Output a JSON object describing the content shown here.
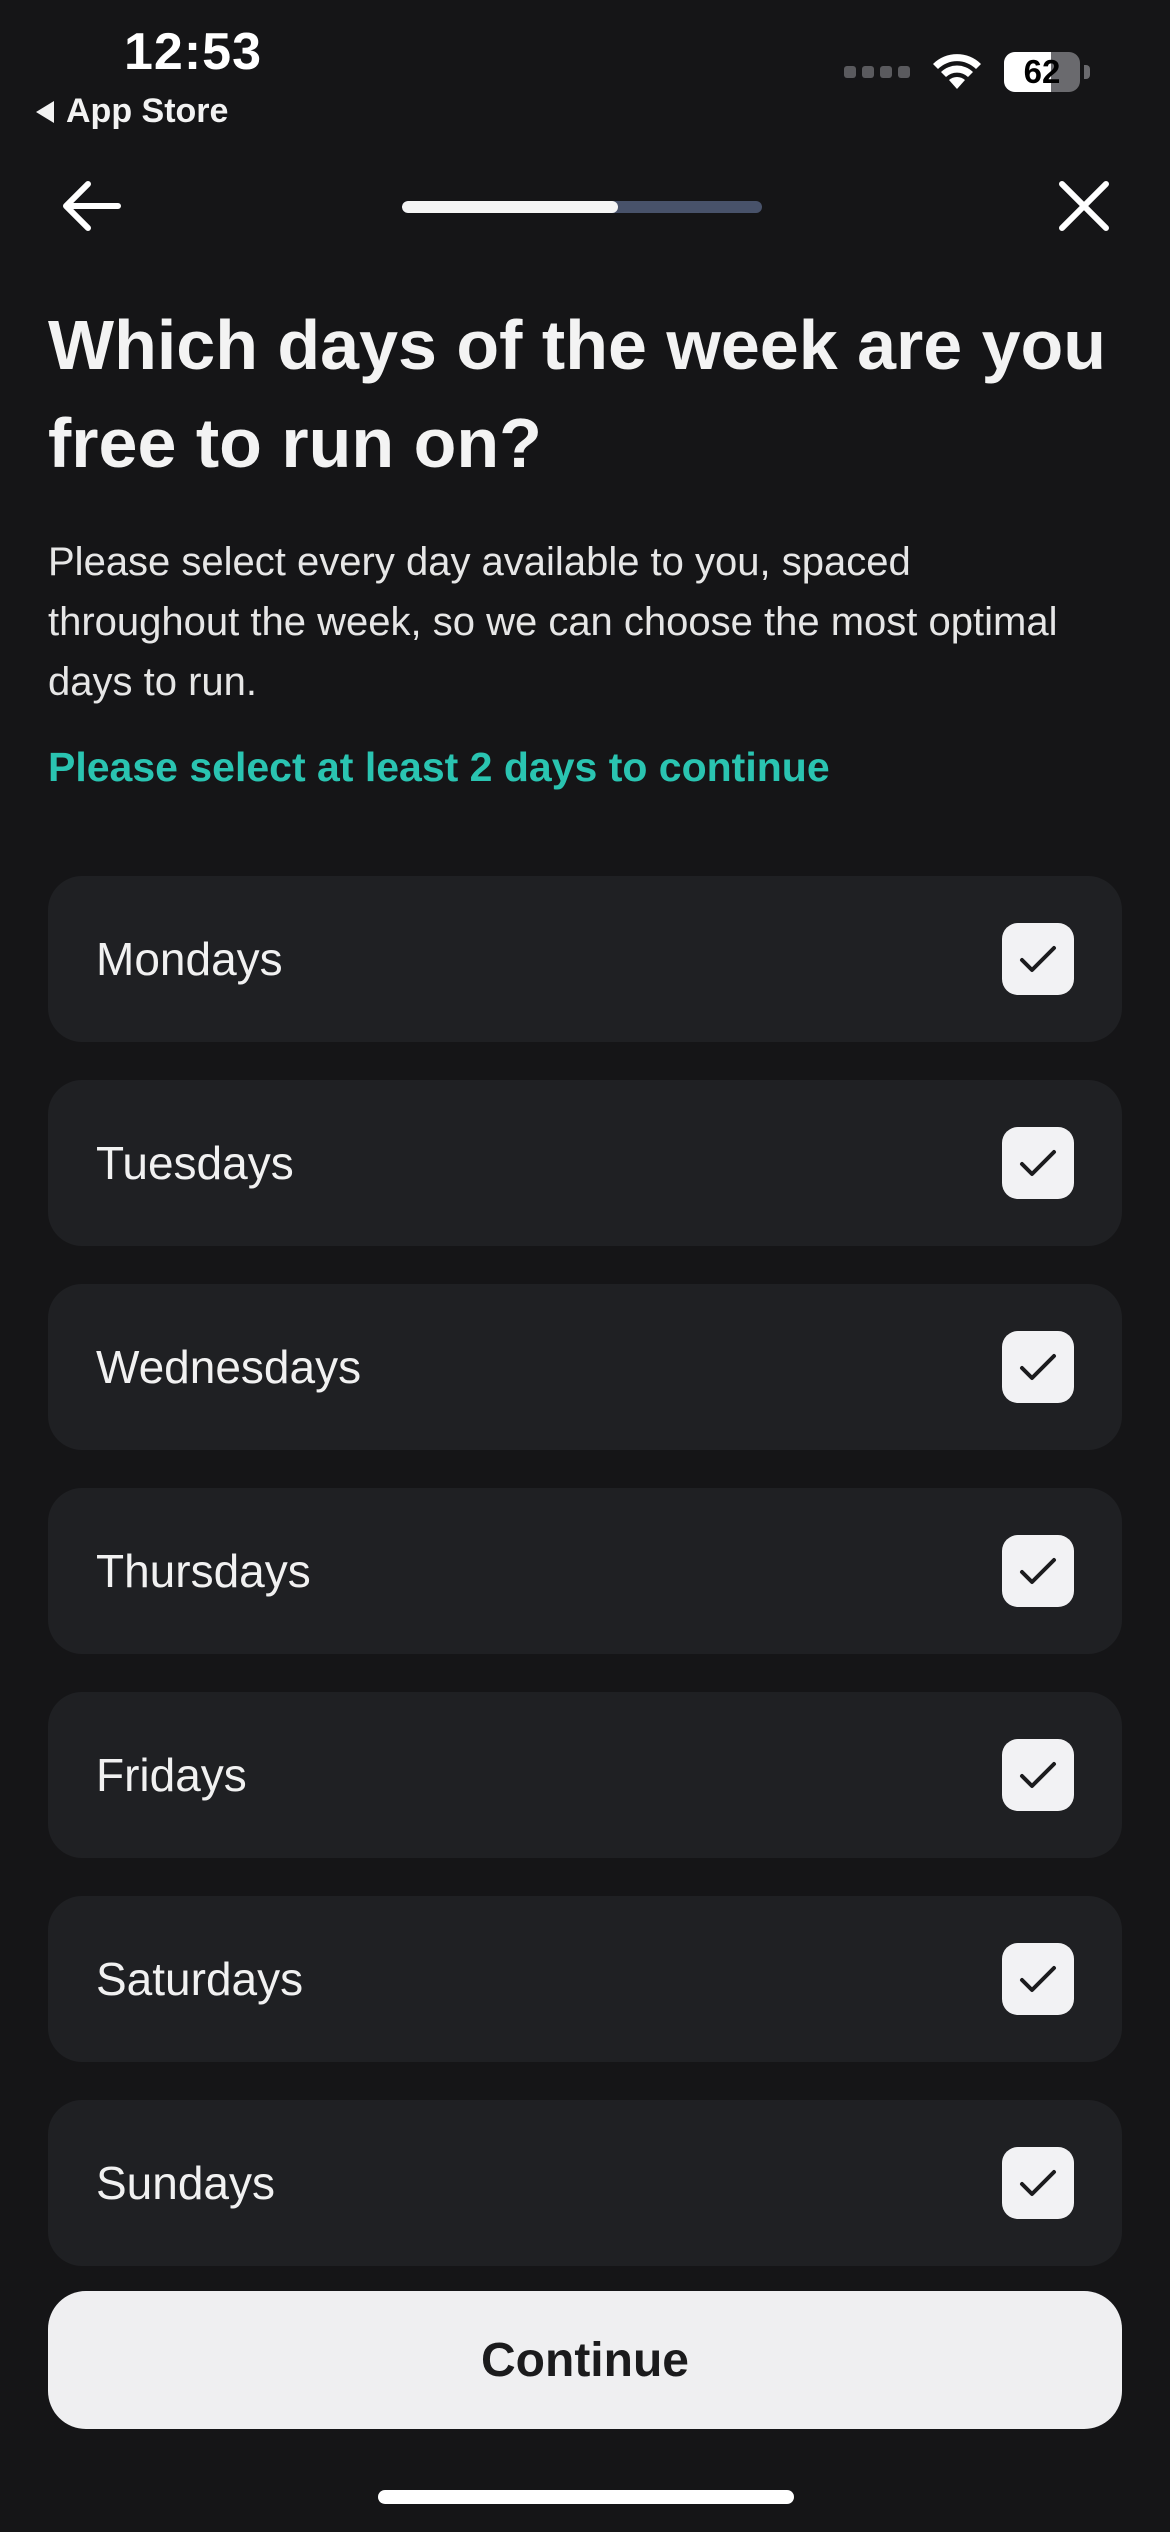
{
  "status_bar": {
    "time": "12:53",
    "back_app": "App Store",
    "battery": "62",
    "battery_level": 0.62
  },
  "nav": {
    "progress": 0.6
  },
  "title": "Which days of the week are you free to run on?",
  "subtitle": "Please select every day available to you, spaced throughout the week, so we can choose the most optimal days to run.",
  "hint": "Please select at least 2 days to continue",
  "days": [
    {
      "label": "Mondays",
      "checked": true
    },
    {
      "label": "Tuesdays",
      "checked": true
    },
    {
      "label": "Wednesdays",
      "checked": true
    },
    {
      "label": "Thursdays",
      "checked": true
    },
    {
      "label": "Fridays",
      "checked": true
    },
    {
      "label": "Saturdays",
      "checked": true
    },
    {
      "label": "Sundays",
      "checked": true
    }
  ],
  "continue_label": "Continue",
  "colors": {
    "background": "#151517",
    "card": "#1f2023",
    "accent": "#2ac4b1",
    "progress_track": "#48526a"
  }
}
